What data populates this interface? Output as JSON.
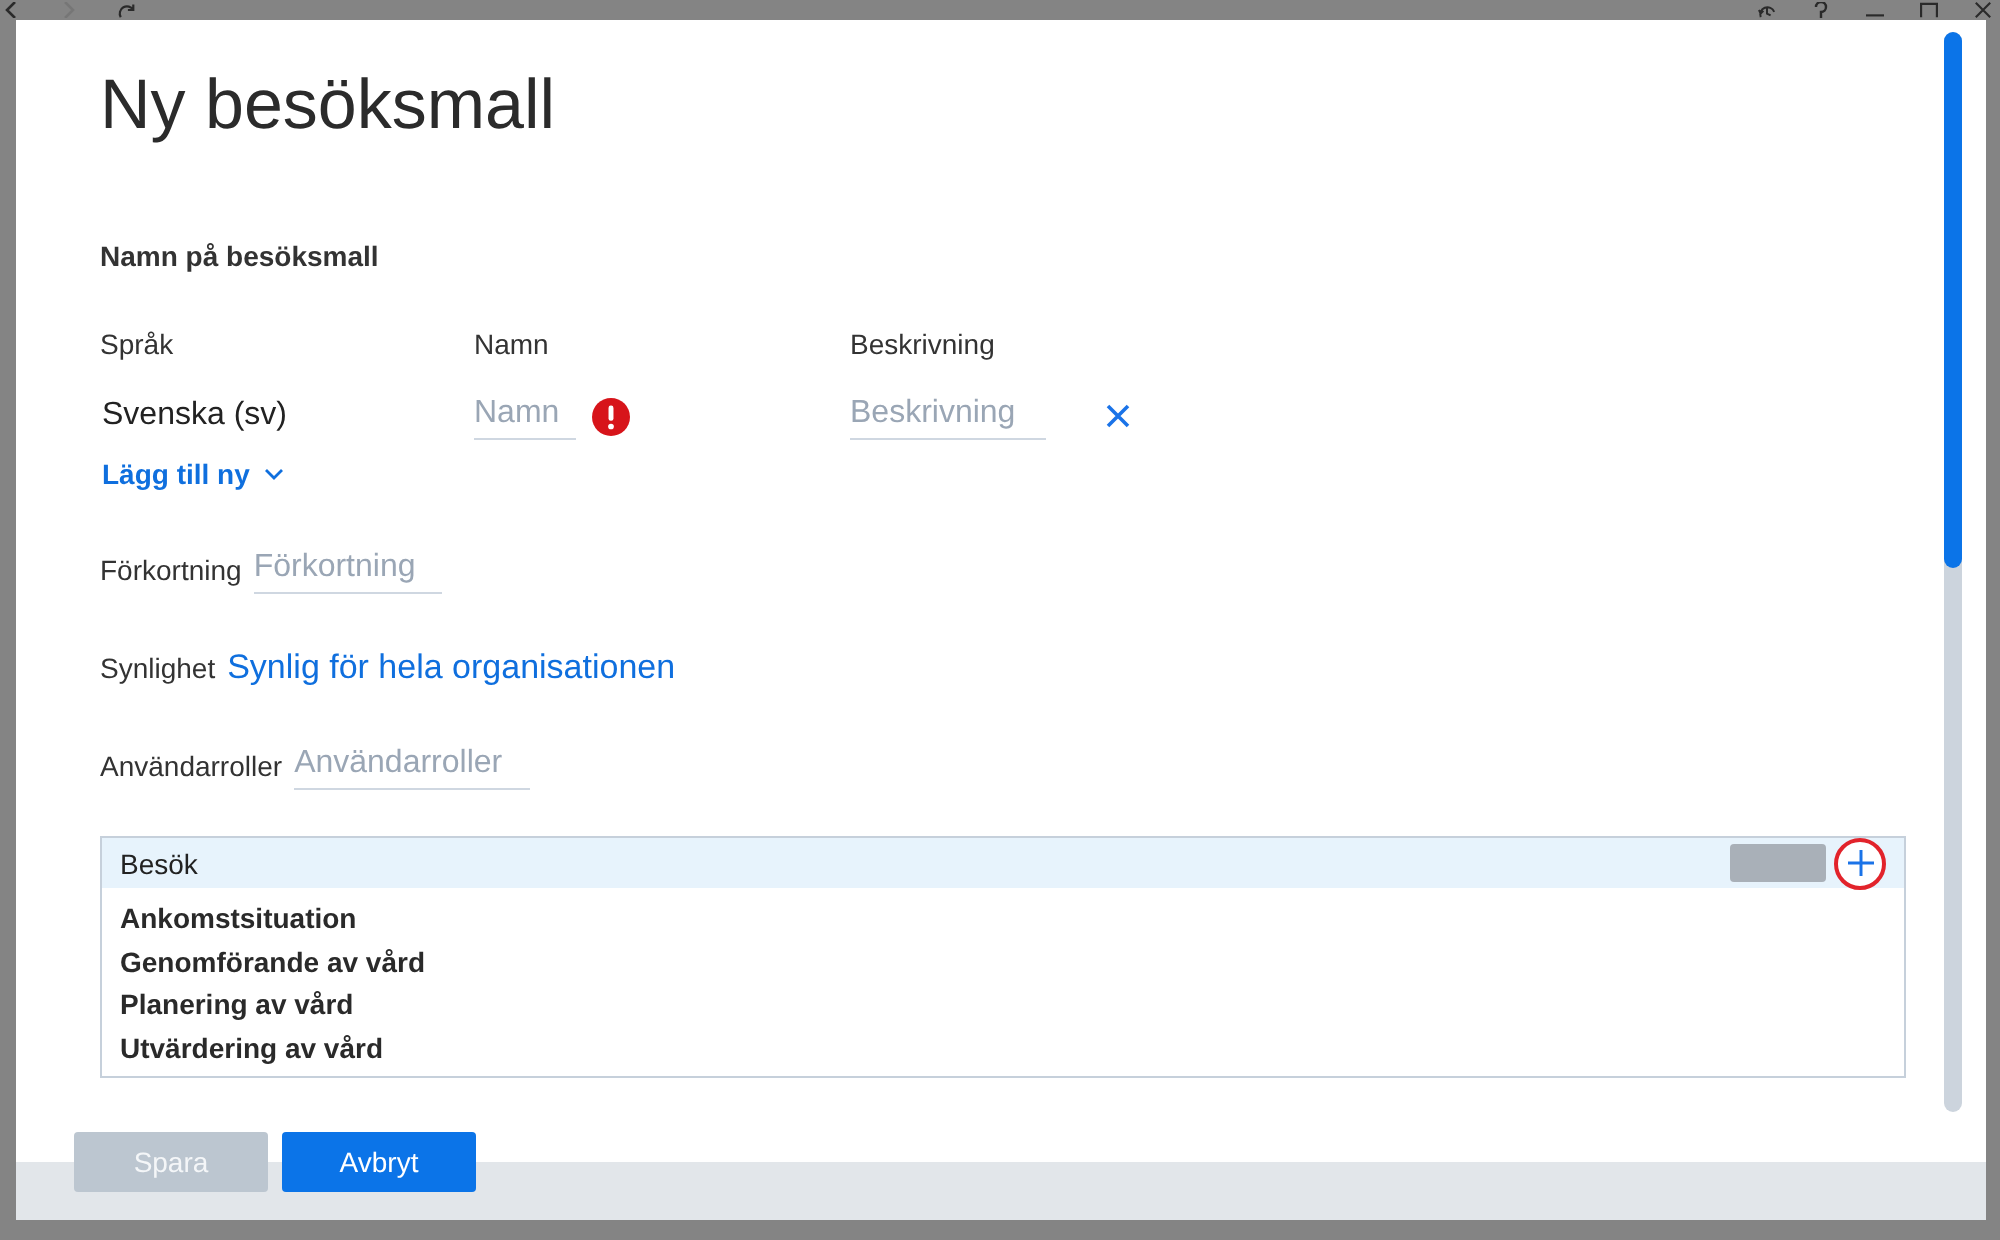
{
  "dialog": {
    "title": "Ny besöksmall"
  },
  "name_section": {
    "heading": "Namn på besöksmall",
    "columns": [
      "Språk",
      "Namn",
      "Beskrivning"
    ],
    "rows": [
      {
        "language": "Svenska (sv)",
        "name": {
          "placeholder": "Namn",
          "error": true
        },
        "description": {
          "placeholder": "Beskrivning"
        }
      }
    ],
    "add_link": "Lägg till ny"
  },
  "fields": [
    {
      "kind": "input",
      "label": "Förkortning",
      "placeholder": "Förkortning"
    },
    {
      "kind": "link",
      "label": "Synlighet",
      "value": "Synlig för hela organisationen"
    },
    {
      "kind": "input",
      "label": "Användarroller",
      "placeholder": "Användarroller"
    }
  ],
  "sections_box": {
    "header": "Besök",
    "items": [
      "Ankomstsituation",
      "Genomförande av vård",
      "Planering av vård",
      "Utvärdering av vård"
    ]
  },
  "buttons": [
    {
      "label": "Spara",
      "disabled": true
    },
    {
      "label": "Avbryt",
      "disabled": false
    }
  ]
}
